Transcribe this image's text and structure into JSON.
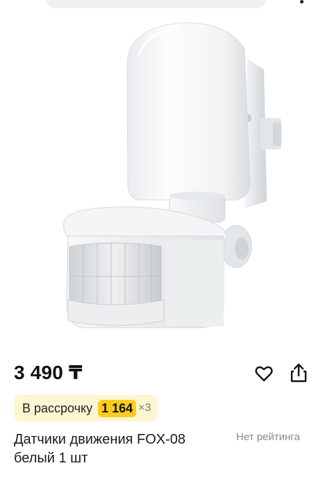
{
  "header": {
    "back_icon": "chevron-left-icon",
    "more_icon": "more-vertical-icon"
  },
  "product": {
    "image_alt_icon": "motion-sensor-image",
    "price": "3 490 ₸",
    "installment": {
      "label": "В рассрочку",
      "amount": "1 164",
      "times": "×3"
    },
    "title": "Датчики движения FOX-08 белый 1 шт",
    "rating_text": "Нет рейтинга"
  },
  "actions": {
    "favorite_icon": "heart-icon",
    "share_icon": "share-icon"
  },
  "colors": {
    "installment_bg": "#fdf6d3",
    "installment_accent": "#ffcc1d"
  }
}
